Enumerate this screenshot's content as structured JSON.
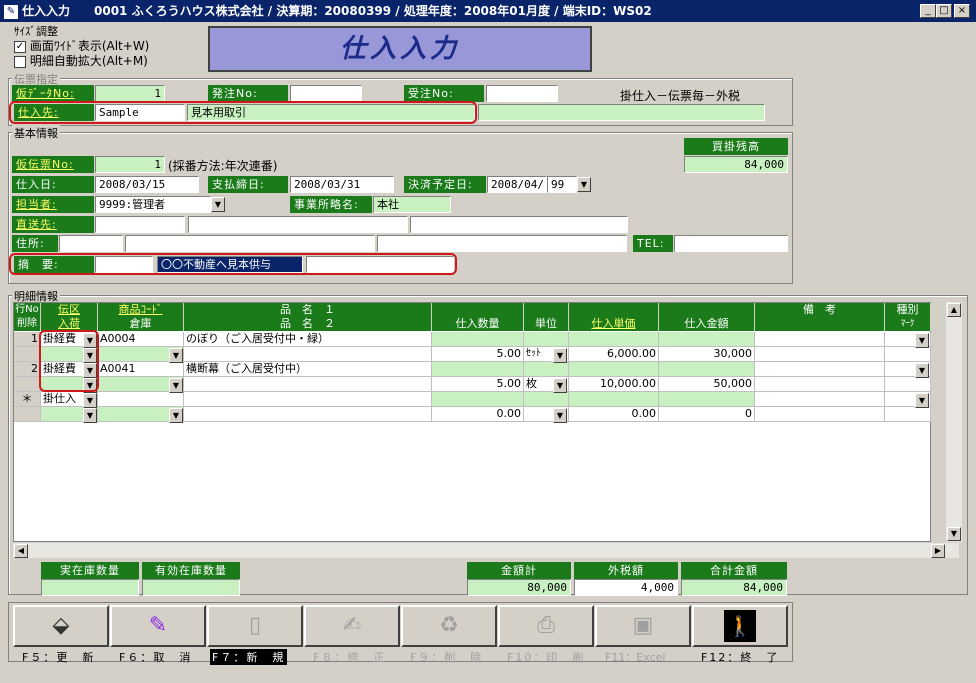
{
  "window": {
    "title": "仕入入力　　0001 ふくろうハウス株式会社 / 決算期：20080399 / 処理年度：2008年01月度 / 端末ID：WS02"
  },
  "size_adjust": {
    "title": "ｻｲｽﾞ調整",
    "wide": "画面ﾜｲﾄﾞ表示(Alt+W)",
    "auto_expand": "明細自動拡大(Alt+M)"
  },
  "screen_title": "仕入入力",
  "voucher": {
    "group": "伝票指定",
    "kari_label": "仮ﾃﾞｰﾀNo:",
    "kari_value": "1",
    "order_label": "発注No:",
    "order_value": "",
    "recv_label": "受注No:",
    "recv_value": "",
    "mode_text": "掛仕入－伝票毎－外税",
    "supplier_label": "仕入先:",
    "supplier_code": "Sample",
    "supplier_name": "見本用取引",
    "supplier_extra": ""
  },
  "basic": {
    "group": "基本情報",
    "balance_label": "買掛残高",
    "balance_value": "84,000",
    "kari_denpyo_label": "仮伝票No:",
    "kari_denpyo_value": "1",
    "numbering": "(採番方法:年次連番)",
    "date_label": "仕入日:",
    "date_value": "2008/03/15",
    "close_label": "支払締日:",
    "close_value": "2008/03/31",
    "settle_label": "決済予定日:",
    "settle_value": "2008/04/",
    "settle_day": "99",
    "staff_label": "担当者:",
    "staff_value": "9999:管理者",
    "office_label": "事業所略名:",
    "office_value": "本社",
    "direct_label": "直送先:",
    "address_label": "住所:",
    "tel_label": "TEL:",
    "memo_label": "摘　要:",
    "memo_value": "〇〇不動産へ見本供与"
  },
  "detail": {
    "group": "明細情報",
    "headers": {
      "row_no": "行No",
      "delete": "削除",
      "kubun": "伝区",
      "nyuka": "入荷",
      "code": "商品ｺｰﾄﾞ",
      "warehouse": "倉庫",
      "name1": "品　名　１",
      "name2": "品　名　２",
      "qty": "仕入数量",
      "unit": "単位",
      "price": "仕入単価",
      "amount": "仕入金額",
      "note": "備　考",
      "type": "種別",
      "mark": "ﾏｰｸ"
    },
    "rows": [
      {
        "no": "1",
        "kubun": "掛経費",
        "code": "A0004",
        "name1": "のぼり（ご入居受付中・緑）",
        "qty": "5.00",
        "unit": "ｾｯﾄ",
        "price": "6,000.00",
        "amount": "30,000"
      },
      {
        "no": "2",
        "kubun": "掛経費",
        "code": "A0041",
        "name1": "横断幕（ご入居受付中）",
        "qty": "5.00",
        "unit": "枚",
        "price": "10,000.00",
        "amount": "50,000"
      },
      {
        "no": "＊",
        "kubun": "掛仕入",
        "code": "",
        "name1": "",
        "qty": "0.00",
        "unit": "",
        "price": "0.00",
        "amount": "0"
      }
    ]
  },
  "footer": {
    "stock_label": "実在庫数量",
    "eff_stock_label": "有効在庫数量",
    "sum_label": "金額計",
    "sum_value": "80,000",
    "tax_label": "外税額",
    "tax_value": "4,000",
    "total_label": "合計金額",
    "total_value": "84,000"
  },
  "fkeys": [
    {
      "label": "F５：更　新",
      "icon": "eraser-icon"
    },
    {
      "label": "F６：取　消",
      "icon": "magic-wand-icon"
    },
    {
      "label": "F７：新　規",
      "icon": "new-page-icon"
    },
    {
      "label": "F８：修　正",
      "icon": "edit-icon"
    },
    {
      "label": "F９：削　除",
      "icon": "recycle-icon"
    },
    {
      "label": "F10：印　刷",
      "icon": "printer-icon"
    },
    {
      "label": "F11：Excel",
      "icon": "excel-icon"
    },
    {
      "label": "F12：終　了",
      "icon": "exit-icon"
    }
  ]
}
